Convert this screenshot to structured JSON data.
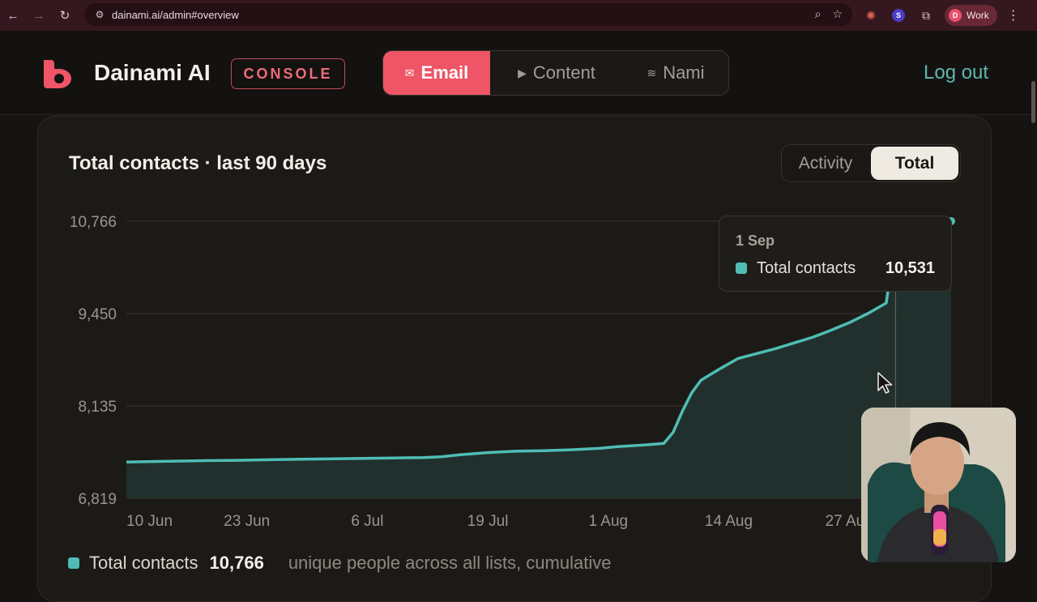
{
  "browser": {
    "url": "dainami.ai/admin#overview",
    "profile_label": "Work",
    "profile_initial": "D",
    "extension_initial": "S"
  },
  "header": {
    "brand": "Dainami AI",
    "badge": "CONSOLE",
    "tabs": [
      {
        "label": "Email",
        "icon": "envelope-icon",
        "glyph": "✉",
        "active": true
      },
      {
        "label": "Content",
        "icon": "play-icon",
        "glyph": "▶",
        "active": false
      },
      {
        "label": "Nami",
        "icon": "wave-icon",
        "glyph": "≋",
        "active": false
      }
    ],
    "logout_label": "Log out"
  },
  "card": {
    "title": "Total contacts · last 90 days",
    "toggle": [
      {
        "label": "Activity",
        "active": false
      },
      {
        "label": "Total",
        "active": true
      }
    ]
  },
  "tooltip": {
    "date": "1 Sep",
    "label": "Total contacts",
    "value": "10,531"
  },
  "legend": {
    "label": "Total contacts",
    "value": "10,766",
    "note": "unique people across all lists, cumulative"
  },
  "colors": {
    "accent": "#ee5566",
    "series": "#4fbdb4",
    "link": "#5fb8b0"
  },
  "chart_data": {
    "type": "area",
    "title": "Total contacts · last 90 days",
    "y_ticks": [
      "10,766",
      "9,450",
      "8,135",
      "6,819"
    ],
    "ylim": [
      6819,
      10766
    ],
    "x_ticks": [
      "10 Jun",
      "23 Jun",
      "6 Jul",
      "19 Jul",
      "1 Aug",
      "14 Aug",
      "27 Aug"
    ],
    "grid": true,
    "series": [
      {
        "name": "Total contacts",
        "x": [
          "10 Jun",
          "14 Jun",
          "18 Jun",
          "22 Jun",
          "26 Jun",
          "30 Jun",
          "4 Jul",
          "8 Jul",
          "12 Jul",
          "14 Jul",
          "16 Jul",
          "19 Jul",
          "22 Jul",
          "25 Jul",
          "28 Jul",
          "31 Jul",
          "2 Aug",
          "5 Aug",
          "7 Aug",
          "8 Aug",
          "9 Aug",
          "10 Aug",
          "11 Aug",
          "13 Aug",
          "15 Aug",
          "17 Aug",
          "19 Aug",
          "21 Aug",
          "23 Aug",
          "25 Aug",
          "27 Aug",
          "29 Aug",
          "31 Aug",
          "1 Sep",
          "5 Sep",
          "7 Sep"
        ],
        "values": [
          7335,
          7345,
          7355,
          7360,
          7370,
          7378,
          7385,
          7392,
          7400,
          7410,
          7440,
          7470,
          7490,
          7498,
          7510,
          7530,
          7555,
          7580,
          7600,
          7760,
          8060,
          8320,
          8500,
          8660,
          8810,
          8880,
          8950,
          9030,
          9110,
          9210,
          9320,
          9450,
          9600,
          10531,
          10650,
          10766
        ]
      }
    ]
  }
}
